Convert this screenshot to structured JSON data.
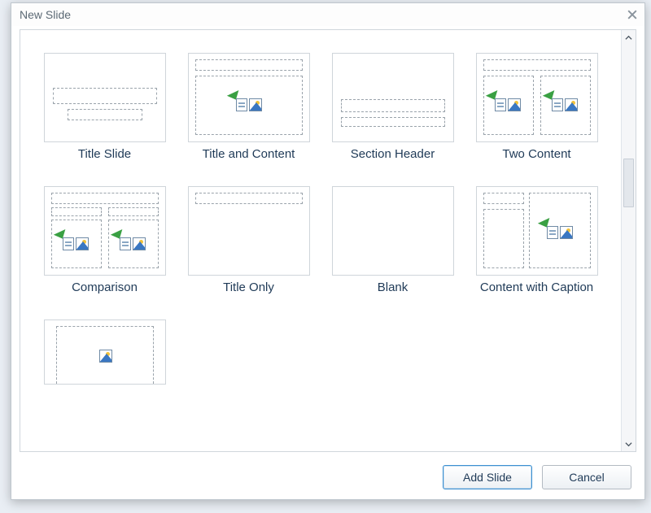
{
  "dialog": {
    "title": "New Slide",
    "close_tooltip": "Close"
  },
  "layouts": [
    {
      "id": "title-slide",
      "label": "Title Slide"
    },
    {
      "id": "title-and-content",
      "label": "Title and Content"
    },
    {
      "id": "section-header",
      "label": "Section Header"
    },
    {
      "id": "two-content",
      "label": "Two Content"
    },
    {
      "id": "comparison",
      "label": "Comparison"
    },
    {
      "id": "title-only",
      "label": "Title Only"
    },
    {
      "id": "blank",
      "label": "Blank"
    },
    {
      "id": "content-with-caption",
      "label": "Content with Caption"
    },
    {
      "id": "picture-with-caption",
      "label": ""
    }
  ],
  "buttons": {
    "add_slide": "Add Slide",
    "cancel": "Cancel"
  }
}
